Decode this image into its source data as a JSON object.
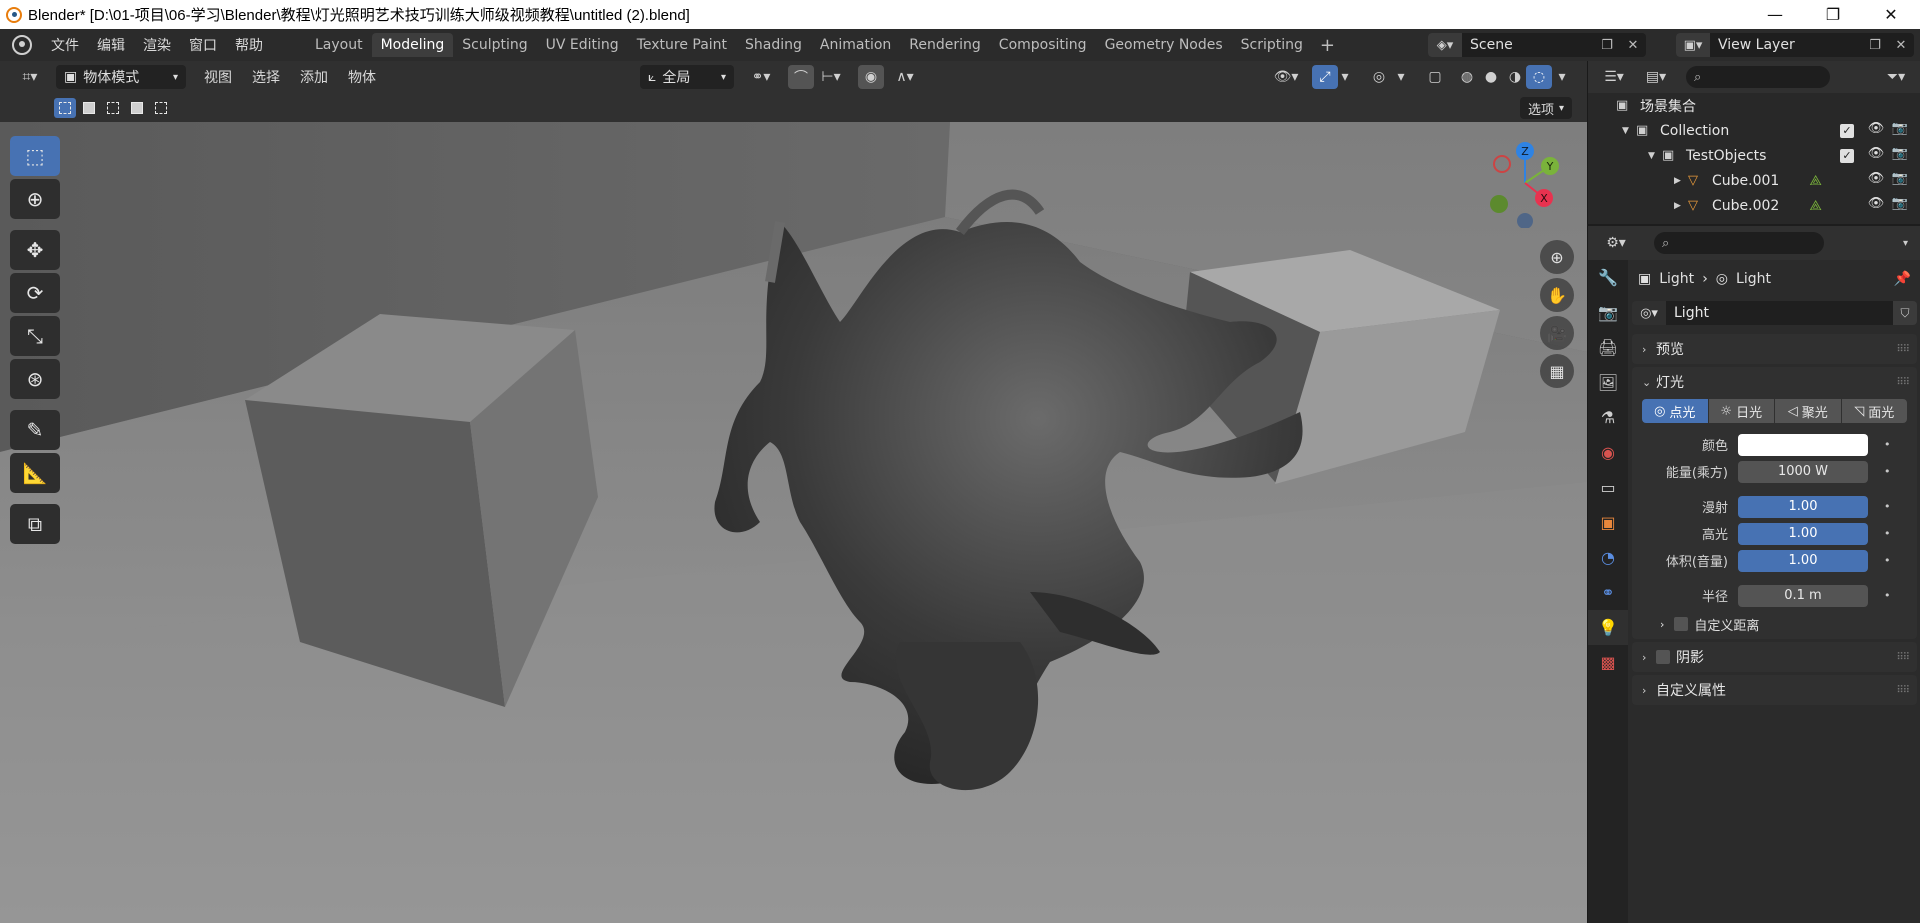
{
  "window": {
    "title": "Blender* [D:\\01-项目\\06-学习\\Blender\\教程\\灯光照明艺术技巧训练大师级视频教程\\untitled (2).blend]",
    "minimize": "—",
    "maximize": "❐",
    "close": "✕"
  },
  "menu": [
    "文件",
    "编辑",
    "渲染",
    "窗口",
    "帮助"
  ],
  "workspaces": [
    "Layout",
    "Modeling",
    "Sculpting",
    "UV Editing",
    "Texture Paint",
    "Shading",
    "Animation",
    "Rendering",
    "Compositing",
    "Geometry Nodes",
    "Scripting"
  ],
  "active_workspace": "Modeling",
  "scene": {
    "name": "Scene"
  },
  "view_layer": {
    "name": "View Layer"
  },
  "viewport_header": {
    "mode": "物体模式",
    "menus": [
      "视图",
      "选择",
      "添加",
      "物体"
    ],
    "transform_orientation": "全局"
  },
  "tool_settings": {
    "options_label": "选项"
  },
  "gizmo": {
    "x": "X",
    "y": "Y",
    "z": "Z"
  },
  "outliner": {
    "root": "场景集合",
    "rows": [
      {
        "name": "Collection"
      },
      {
        "name": "TestObjects"
      },
      {
        "name": "Cube.001"
      },
      {
        "name": "Cube.002"
      }
    ]
  },
  "properties": {
    "breadcrumb": [
      "Light",
      "Light"
    ],
    "datablock": "Light",
    "panels": {
      "preview": "预览",
      "light": "灯光",
      "shadow": "阴影",
      "custom_props": "自定义属性",
      "custom_distance": "自定义距离"
    },
    "light_types": [
      "点光",
      "日光",
      "聚光",
      "面光"
    ],
    "active_light_type": "点光",
    "fields": [
      {
        "label": "颜色",
        "value": ""
      },
      {
        "label": "能量(乘方)",
        "value": "1000 W"
      },
      {
        "label": "漫射",
        "value": "1.00"
      },
      {
        "label": "高光",
        "value": "1.00"
      },
      {
        "label": "体积(音量)",
        "value": "1.00"
      },
      {
        "label": "半径",
        "value": "0.1 m"
      }
    ]
  },
  "colors": {
    "accent": "#4772b3",
    "axis_x": "#e8324f",
    "axis_y": "#7ab33b",
    "axis_z": "#2f83e3"
  }
}
